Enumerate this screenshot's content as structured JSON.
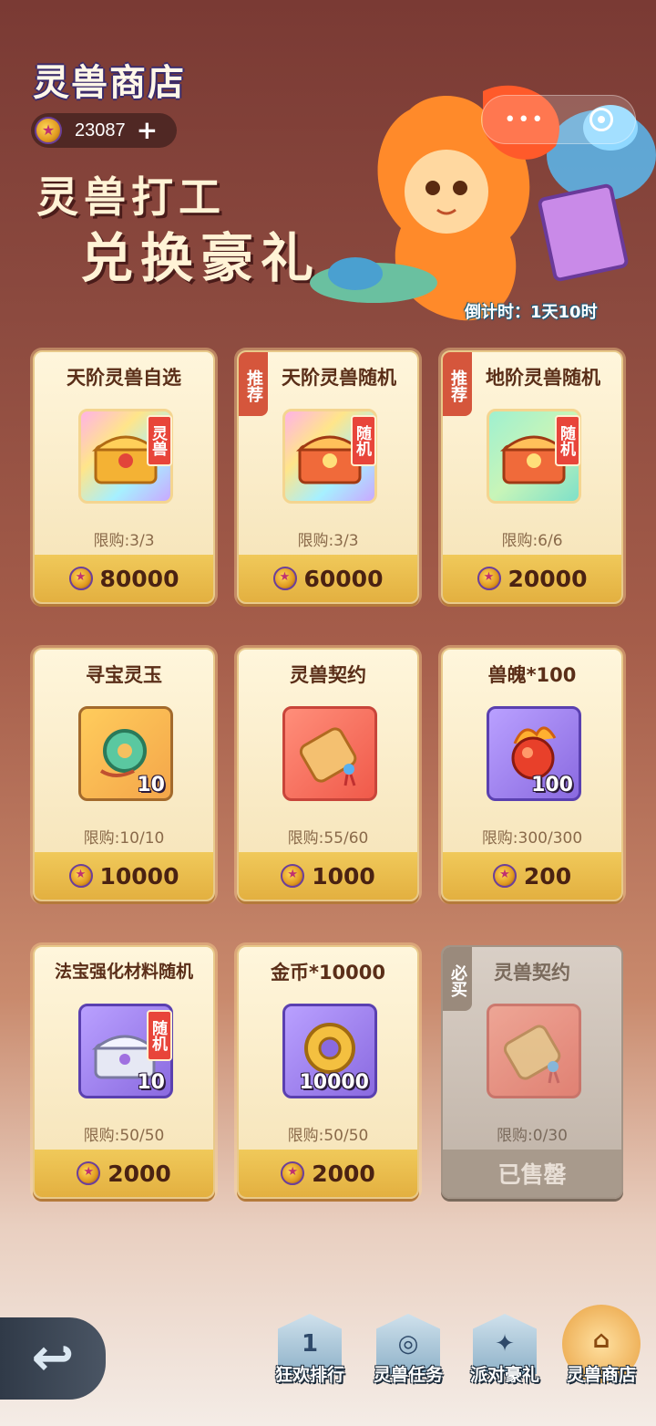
{
  "header": {
    "title": "灵兽商店",
    "currency_value": "23087"
  },
  "banner": {
    "line1": "灵兽打工",
    "line2": "兑换豪礼",
    "countdown": "倒计时：1天10时"
  },
  "cards": [
    {
      "name": "天阶灵兽自选",
      "tag": "",
      "badge": "灵兽",
      "qty": "",
      "limit": "限购:3/3",
      "price": "80000"
    },
    {
      "name": "天阶灵兽随机",
      "tag": "推荐",
      "badge": "随机",
      "qty": "",
      "limit": "限购:3/3",
      "price": "60000"
    },
    {
      "name": "地阶灵兽随机",
      "tag": "推荐",
      "badge": "随机",
      "qty": "",
      "limit": "限购:6/6",
      "price": "20000"
    },
    {
      "name": "寻宝灵玉",
      "tag": "",
      "badge": "",
      "qty": "10",
      "limit": "限购:10/10",
      "price": "10000"
    },
    {
      "name": "灵兽契约",
      "tag": "",
      "badge": "",
      "qty": "",
      "limit": "限购:55/60",
      "price": "1000"
    },
    {
      "name": "兽魄*100",
      "tag": "",
      "badge": "",
      "qty": "100",
      "limit": "限购:300/300",
      "price": "200"
    },
    {
      "name": "法宝强化材料随机",
      "tag": "",
      "badge": "随机",
      "qty": "10",
      "limit": "限购:50/50",
      "price": "2000"
    },
    {
      "name": "金币*10000",
      "tag": "",
      "badge": "",
      "qty": "10000",
      "limit": "限购:50/50",
      "price": "2000"
    },
    {
      "name": "灵兽契约",
      "tag": "必买",
      "badge": "",
      "qty": "",
      "limit": "限购:0/30",
      "price": "已售罄"
    }
  ],
  "nav": {
    "items": [
      {
        "label": "狂欢排行",
        "emblem": "1"
      },
      {
        "label": "灵兽任务",
        "emblem": "◎"
      },
      {
        "label": "派对豪礼",
        "emblem": "✦"
      },
      {
        "label": "灵兽商店",
        "emblem": "⌂"
      }
    ]
  }
}
